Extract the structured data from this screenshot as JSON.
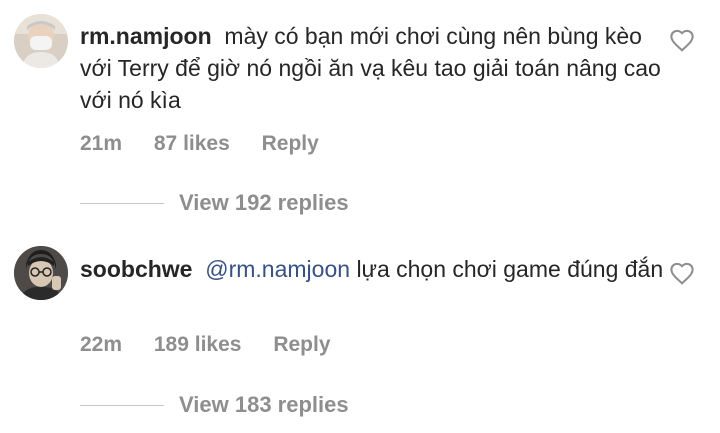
{
  "comments": [
    {
      "username": "rm.namjoon",
      "mention": "",
      "text": "mày có bạn mới chơi cùng nên bùng kèo với Terry để giờ nó ngồi ăn vạ kêu tao giải toán nâng cao với nó kìa",
      "time": "21m",
      "likes": "87 likes",
      "reply_label": "Reply",
      "view_replies": "View 192 replies",
      "avatar_icon": "avatar-photo-masked-person",
      "like_icon": "heart-outline-icon"
    },
    {
      "username": "soobchwe",
      "mention": "@rm.namjoon",
      "text": "lựa chọn chơi game đúng đắn",
      "time": "22m",
      "likes": "189 likes",
      "reply_label": "Reply",
      "view_replies": "View 183 replies",
      "avatar_icon": "avatar-photo-person-glasses",
      "like_icon": "heart-outline-icon"
    }
  ]
}
